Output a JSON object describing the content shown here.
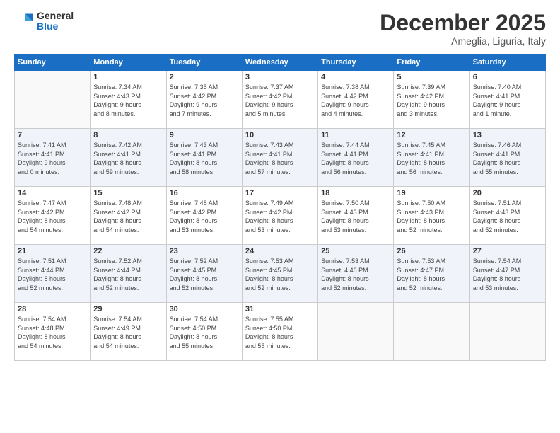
{
  "logo": {
    "general": "General",
    "blue": "Blue"
  },
  "header": {
    "month": "December 2025",
    "location": "Ameglia, Liguria, Italy"
  },
  "weekdays": [
    "Sunday",
    "Monday",
    "Tuesday",
    "Wednesday",
    "Thursday",
    "Friday",
    "Saturday"
  ],
  "weeks": [
    [
      {
        "day": "",
        "info": ""
      },
      {
        "day": "1",
        "info": "Sunrise: 7:34 AM\nSunset: 4:43 PM\nDaylight: 9 hours\nand 8 minutes."
      },
      {
        "day": "2",
        "info": "Sunrise: 7:35 AM\nSunset: 4:42 PM\nDaylight: 9 hours\nand 7 minutes."
      },
      {
        "day": "3",
        "info": "Sunrise: 7:37 AM\nSunset: 4:42 PM\nDaylight: 9 hours\nand 5 minutes."
      },
      {
        "day": "4",
        "info": "Sunrise: 7:38 AM\nSunset: 4:42 PM\nDaylight: 9 hours\nand 4 minutes."
      },
      {
        "day": "5",
        "info": "Sunrise: 7:39 AM\nSunset: 4:42 PM\nDaylight: 9 hours\nand 3 minutes."
      },
      {
        "day": "6",
        "info": "Sunrise: 7:40 AM\nSunset: 4:41 PM\nDaylight: 9 hours\nand 1 minute."
      }
    ],
    [
      {
        "day": "7",
        "info": "Sunrise: 7:41 AM\nSunset: 4:41 PM\nDaylight: 9 hours\nand 0 minutes."
      },
      {
        "day": "8",
        "info": "Sunrise: 7:42 AM\nSunset: 4:41 PM\nDaylight: 8 hours\nand 59 minutes."
      },
      {
        "day": "9",
        "info": "Sunrise: 7:43 AM\nSunset: 4:41 PM\nDaylight: 8 hours\nand 58 minutes."
      },
      {
        "day": "10",
        "info": "Sunrise: 7:43 AM\nSunset: 4:41 PM\nDaylight: 8 hours\nand 57 minutes."
      },
      {
        "day": "11",
        "info": "Sunrise: 7:44 AM\nSunset: 4:41 PM\nDaylight: 8 hours\nand 56 minutes."
      },
      {
        "day": "12",
        "info": "Sunrise: 7:45 AM\nSunset: 4:41 PM\nDaylight: 8 hours\nand 56 minutes."
      },
      {
        "day": "13",
        "info": "Sunrise: 7:46 AM\nSunset: 4:41 PM\nDaylight: 8 hours\nand 55 minutes."
      }
    ],
    [
      {
        "day": "14",
        "info": "Sunrise: 7:47 AM\nSunset: 4:42 PM\nDaylight: 8 hours\nand 54 minutes."
      },
      {
        "day": "15",
        "info": "Sunrise: 7:48 AM\nSunset: 4:42 PM\nDaylight: 8 hours\nand 54 minutes."
      },
      {
        "day": "16",
        "info": "Sunrise: 7:48 AM\nSunset: 4:42 PM\nDaylight: 8 hours\nand 53 minutes."
      },
      {
        "day": "17",
        "info": "Sunrise: 7:49 AM\nSunset: 4:42 PM\nDaylight: 8 hours\nand 53 minutes."
      },
      {
        "day": "18",
        "info": "Sunrise: 7:50 AM\nSunset: 4:43 PM\nDaylight: 8 hours\nand 53 minutes."
      },
      {
        "day": "19",
        "info": "Sunrise: 7:50 AM\nSunset: 4:43 PM\nDaylight: 8 hours\nand 52 minutes."
      },
      {
        "day": "20",
        "info": "Sunrise: 7:51 AM\nSunset: 4:43 PM\nDaylight: 8 hours\nand 52 minutes."
      }
    ],
    [
      {
        "day": "21",
        "info": "Sunrise: 7:51 AM\nSunset: 4:44 PM\nDaylight: 8 hours\nand 52 minutes."
      },
      {
        "day": "22",
        "info": "Sunrise: 7:52 AM\nSunset: 4:44 PM\nDaylight: 8 hours\nand 52 minutes."
      },
      {
        "day": "23",
        "info": "Sunrise: 7:52 AM\nSunset: 4:45 PM\nDaylight: 8 hours\nand 52 minutes."
      },
      {
        "day": "24",
        "info": "Sunrise: 7:53 AM\nSunset: 4:45 PM\nDaylight: 8 hours\nand 52 minutes."
      },
      {
        "day": "25",
        "info": "Sunrise: 7:53 AM\nSunset: 4:46 PM\nDaylight: 8 hours\nand 52 minutes."
      },
      {
        "day": "26",
        "info": "Sunrise: 7:53 AM\nSunset: 4:47 PM\nDaylight: 8 hours\nand 52 minutes."
      },
      {
        "day": "27",
        "info": "Sunrise: 7:54 AM\nSunset: 4:47 PM\nDaylight: 8 hours\nand 53 minutes."
      }
    ],
    [
      {
        "day": "28",
        "info": "Sunrise: 7:54 AM\nSunset: 4:48 PM\nDaylight: 8 hours\nand 54 minutes."
      },
      {
        "day": "29",
        "info": "Sunrise: 7:54 AM\nSunset: 4:49 PM\nDaylight: 8 hours\nand 54 minutes."
      },
      {
        "day": "30",
        "info": "Sunrise: 7:54 AM\nSunset: 4:50 PM\nDaylight: 8 hours\nand 55 minutes."
      },
      {
        "day": "31",
        "info": "Sunrise: 7:55 AM\nSunset: 4:50 PM\nDaylight: 8 hours\nand 55 minutes."
      },
      {
        "day": "",
        "info": ""
      },
      {
        "day": "",
        "info": ""
      },
      {
        "day": "",
        "info": ""
      }
    ]
  ]
}
